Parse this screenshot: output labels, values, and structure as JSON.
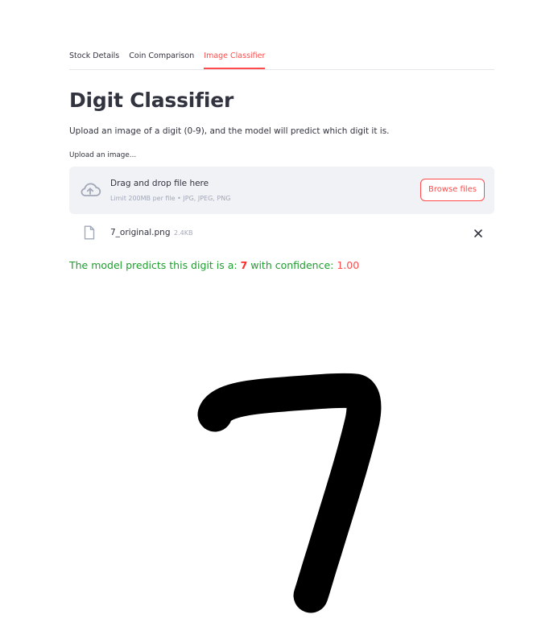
{
  "tabs": [
    {
      "label": "Stock Details",
      "active": false
    },
    {
      "label": "Coin Comparison",
      "active": false
    },
    {
      "label": "Image Classifier",
      "active": true
    }
  ],
  "page": {
    "title": "Digit Classifier",
    "subtitle": "Upload an image of a digit (0-9), and the model will predict which digit it is."
  },
  "uploader": {
    "label": "Upload an image...",
    "drop_text": "Drag and drop file here",
    "limit_text": "Limit 200MB per file • JPG, JPEG, PNG",
    "browse_label": "Browse files",
    "icon": "cloud-upload-icon"
  },
  "file": {
    "name": "7_original.png",
    "size": "2.4KB",
    "icon": "file-icon",
    "remove_icon": "close-icon"
  },
  "prediction": {
    "prefix": "The model predicts this digit is a: ",
    "digit": "7",
    "middle": " with confidence: ",
    "confidence": "1.00"
  },
  "colors": {
    "accent": "#ff4b4b",
    "success_text": "#1e9e2e",
    "dropzone_bg": "#f0f2f6",
    "text": "#31333f"
  }
}
